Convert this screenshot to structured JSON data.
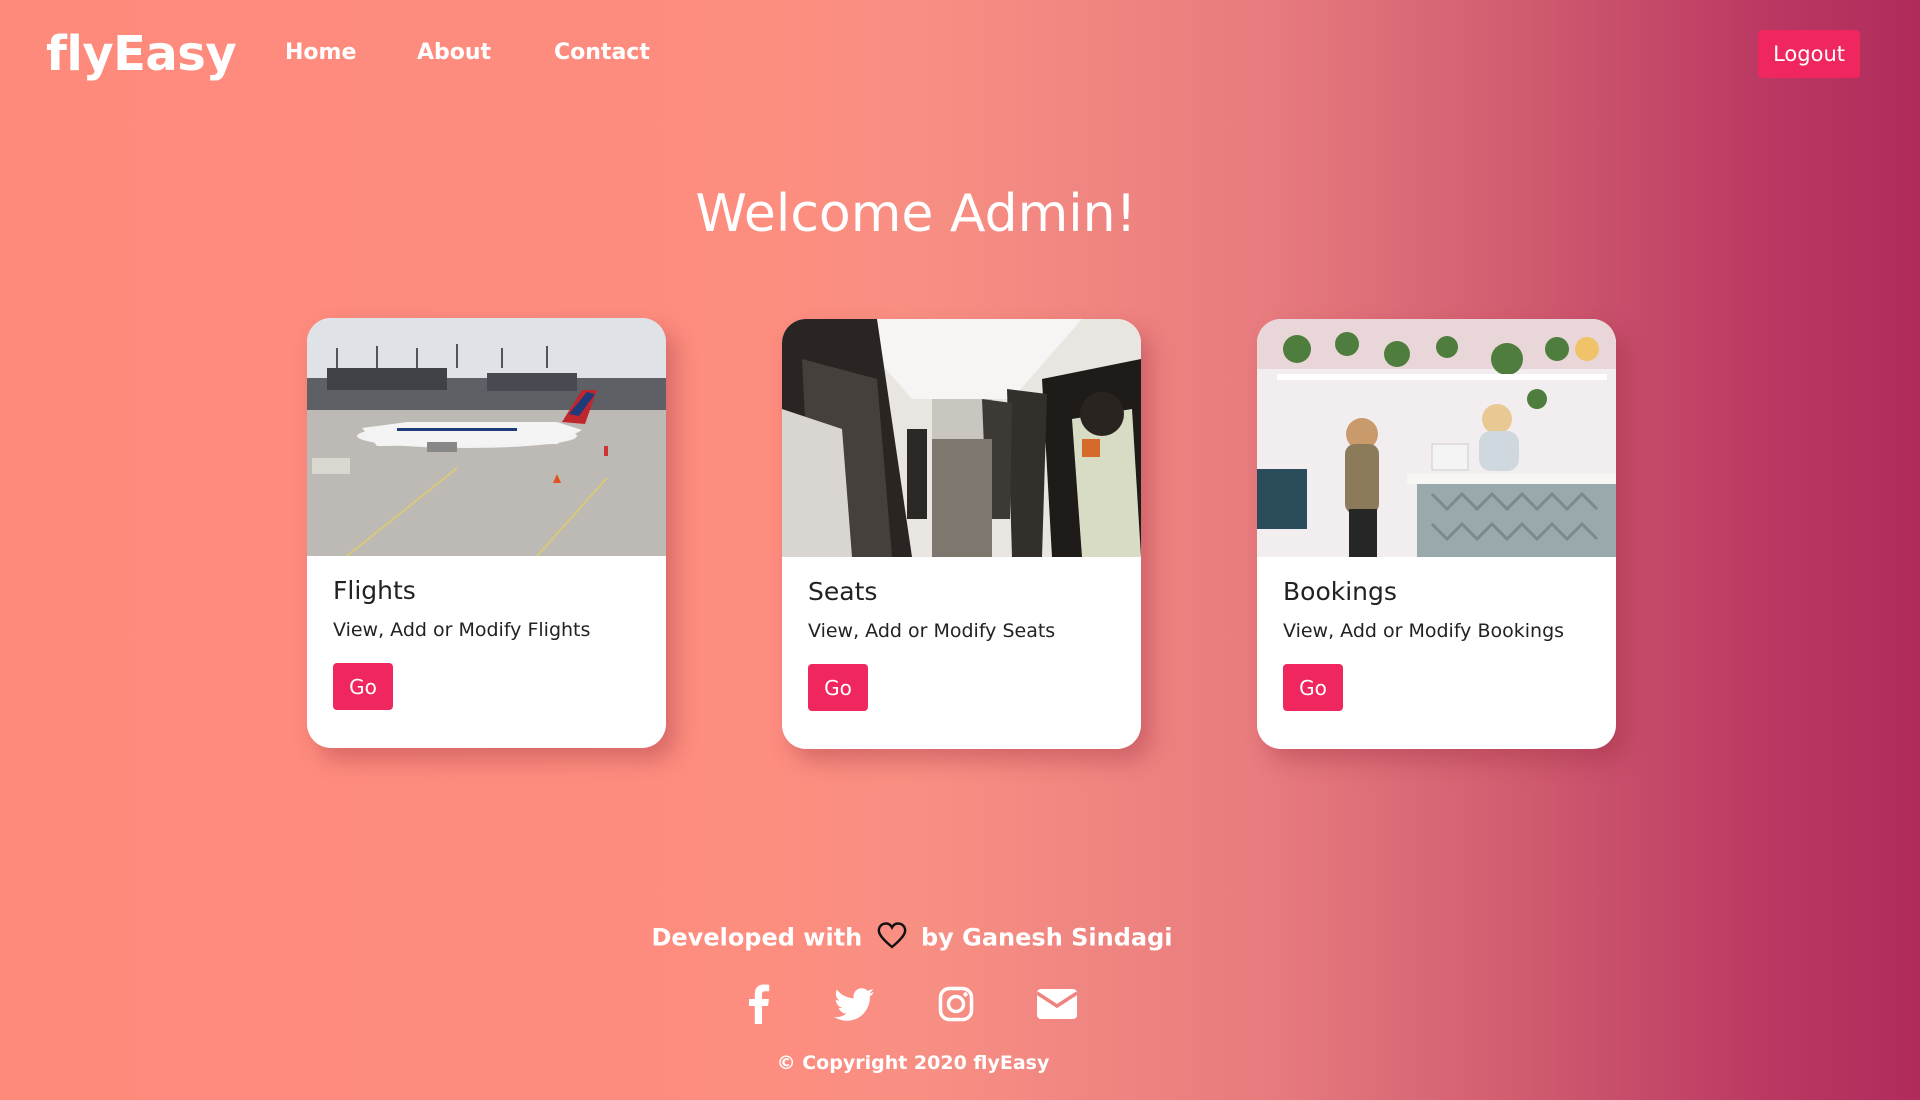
{
  "brand": "flyEasy",
  "nav": {
    "home": "Home",
    "about": "About",
    "contact": "Contact",
    "logout": "Logout"
  },
  "welcome": "Welcome Admin!",
  "cards": [
    {
      "title": "Flights",
      "desc": "View, Add or Modify Flights",
      "button": "Go"
    },
    {
      "title": "Seats",
      "desc": "View, Add or Modify Seats",
      "button": "Go"
    },
    {
      "title": "Bookings",
      "desc": "View, Add or Modify Bookings",
      "button": "Go"
    }
  ],
  "footer": {
    "dev_prefix": "Developed with",
    "dev_suffix": "by Ganesh Sindagi",
    "copyright": "© Copyright 2020 flyEasy",
    "social_icons": [
      "facebook-icon",
      "twitter-icon",
      "instagram-icon",
      "envelope-icon"
    ]
  },
  "colors": {
    "accent": "#f0265e",
    "gradient_start": "#fe8a7c",
    "gradient_end": "#b02b5b"
  }
}
